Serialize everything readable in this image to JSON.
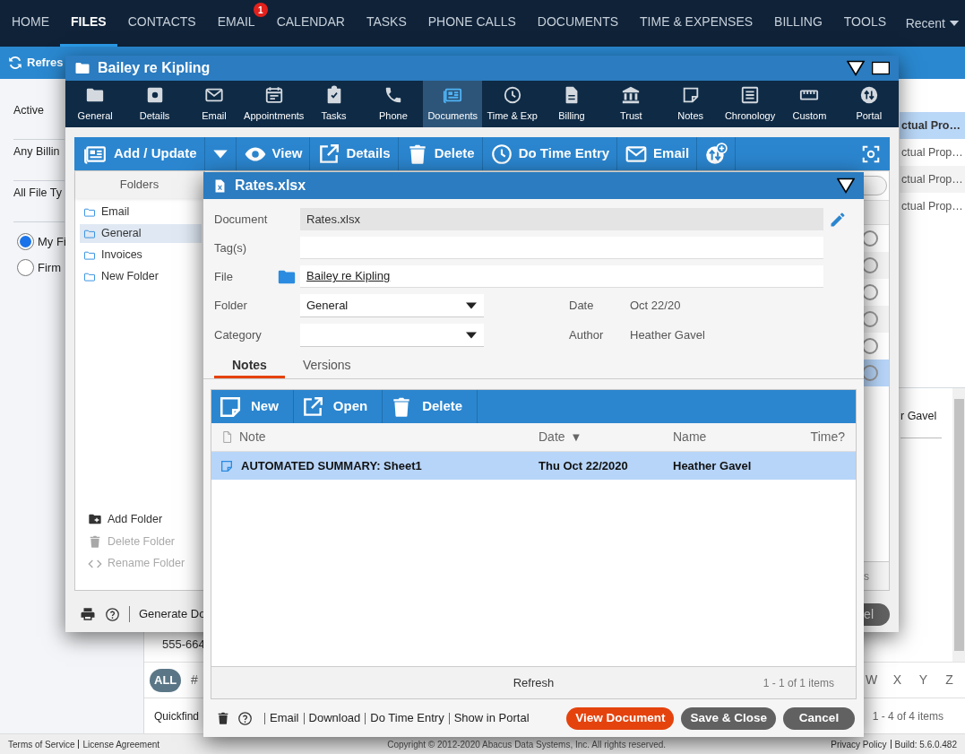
{
  "nav": {
    "items": [
      {
        "label": "HOME",
        "selected": false
      },
      {
        "label": "FILES",
        "selected": true
      },
      {
        "label": "CONTACTS",
        "selected": false
      },
      {
        "label": "EMAIL",
        "selected": false,
        "badge": "1"
      },
      {
        "label": "CALENDAR",
        "selected": false
      },
      {
        "label": "TASKS",
        "selected": false
      },
      {
        "label": "PHONE CALLS",
        "selected": false
      },
      {
        "label": "DOCUMENTS",
        "selected": false
      },
      {
        "label": "TIME & EXPENSES",
        "selected": false
      },
      {
        "label": "BILLING",
        "selected": false
      },
      {
        "label": "TOOLS",
        "selected": false
      }
    ],
    "recent": "Recent"
  },
  "toolbar": {
    "refresh": "Refres"
  },
  "filters": [
    "Active",
    "Any Billin",
    "All File Ty"
  ],
  "scope": [
    {
      "label": "My Fi",
      "selected": true
    },
    {
      "label": "Firm",
      "selected": false
    }
  ],
  "files_list": [
    {
      "text": "ctual Pro…",
      "selected": true
    },
    {
      "text": "ctual Prop…",
      "selected": false
    },
    {
      "text": "ctual Prop…",
      "selected": false
    },
    {
      "text": "ctual Prop…",
      "selected": false
    }
  ],
  "detail": {
    "name": "r Gavel",
    "phone": "555-664"
  },
  "alphabet": {
    "start": [
      {
        "label": "ALL",
        "selected": true
      },
      {
        "label": "#",
        "selected": false
      }
    ],
    "end": [
      {
        "label": "W",
        "selected": false
      },
      {
        "label": "X",
        "selected": false
      },
      {
        "label": "Y",
        "selected": false
      },
      {
        "label": "Z",
        "selected": false
      }
    ]
  },
  "quickfind": "Quickfind",
  "pager": "1 - 4 of 4 items",
  "footer": {
    "links": [
      "Terms of Service",
      "License Agreement"
    ],
    "copyright": "Copyright © 2012-2020 Abacus Data Systems, Inc. All rights reserved.",
    "right": [
      "Privacy Policy",
      "Build: 5.6.0.482"
    ]
  },
  "file_window": {
    "title": "Bailey re Kipling",
    "tabs": [
      {
        "label": "General",
        "selected": false
      },
      {
        "label": "Details",
        "selected": false
      },
      {
        "label": "Email",
        "selected": false
      },
      {
        "label": "Appointments",
        "selected": false
      },
      {
        "label": "Tasks",
        "selected": false
      },
      {
        "label": "Phone",
        "selected": false
      },
      {
        "label": "Documents",
        "selected": true
      },
      {
        "label": "Time & Exp",
        "selected": false
      },
      {
        "label": "Billing",
        "selected": false
      },
      {
        "label": "Trust",
        "selected": false
      },
      {
        "label": "Notes",
        "selected": false
      },
      {
        "label": "Chronology",
        "selected": false
      },
      {
        "label": "Custom",
        "selected": false
      },
      {
        "label": "Portal",
        "selected": false
      }
    ],
    "toolbar": [
      {
        "kind": "add",
        "label": "Add / Update"
      },
      {
        "kind": "menu"
      },
      {
        "kind": "view",
        "label": "View"
      },
      {
        "kind": "details",
        "label": "Details"
      },
      {
        "kind": "delete",
        "label": "Delete"
      },
      {
        "kind": "time",
        "label": "Do Time Entry"
      },
      {
        "kind": "email",
        "label": "Email"
      },
      {
        "kind": "upload"
      }
    ],
    "folders_header": "Folders",
    "folders": [
      {
        "label": "Email",
        "selected": false
      },
      {
        "label": "General",
        "selected": true
      },
      {
        "label": "Invoices",
        "selected": false
      },
      {
        "label": "New Folder",
        "selected": false
      }
    ],
    "folder_actions": [
      {
        "kind": "add",
        "label": "Add Folder",
        "disabled": false
      },
      {
        "kind": "delete",
        "label": "Delete Folder",
        "disabled": true
      },
      {
        "kind": "rename",
        "label": "Rename Folder",
        "disabled": true
      }
    ],
    "rows": [
      {
        "selected": false
      },
      {
        "selected": false
      },
      {
        "selected": false
      },
      {
        "selected": false
      },
      {
        "selected": false
      },
      {
        "selected": true
      }
    ],
    "pager": "s",
    "generate": "Generate Do",
    "cancel": "el"
  },
  "document_dialog": {
    "title": "Rates.xlsx",
    "document": {
      "label": "Document",
      "value": "Rates.xlsx"
    },
    "tags": {
      "label": "Tag(s)"
    },
    "file": {
      "label": "File",
      "value": "Bailey re Kipling"
    },
    "folder": {
      "label": "Folder",
      "value": "General"
    },
    "date": {
      "label": "Date",
      "value": "Oct 22/20"
    },
    "category": {
      "label": "Category"
    },
    "author": {
      "label": "Author",
      "value": "Heather Gavel"
    },
    "tabs": [
      {
        "label": "Notes",
        "selected": true
      },
      {
        "label": "Versions",
        "selected": false
      }
    ],
    "notes_toolbar": [
      {
        "kind": "new",
        "label": "New"
      },
      {
        "kind": "open",
        "label": "Open"
      },
      {
        "kind": "delete",
        "label": "Delete"
      }
    ],
    "columns": [
      {
        "label": "Note"
      },
      {
        "label": "Date",
        "sort_indicator": "▼"
      },
      {
        "label": "Name"
      },
      {
        "label": "Time?"
      }
    ],
    "rows": [
      {
        "note": "AUTOMATED SUMMARY: Sheet1",
        "date": "Thu Oct 22/2020",
        "name": "Heather Gavel",
        "selected": true
      }
    ],
    "refresh": "Refresh",
    "pager": "1 - 1 of 1 items",
    "links": [
      "Email",
      "Download",
      "Do Time Entry",
      "Show in Portal"
    ],
    "buttons": [
      {
        "kind": "primary",
        "label": "View Document"
      },
      {
        "kind": "secondary",
        "label": "Save & Close"
      },
      {
        "kind": "secondary",
        "label": "Cancel"
      }
    ]
  }
}
